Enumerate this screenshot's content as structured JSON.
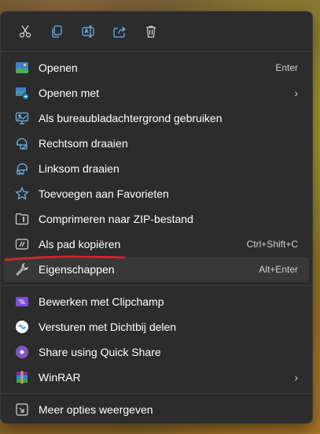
{
  "toolbar": [
    {
      "name": "cut-icon",
      "tooltip": "Knippen"
    },
    {
      "name": "copy-icon",
      "tooltip": "Kopiëren"
    },
    {
      "name": "rename-icon",
      "tooltip": "Naam wijzigen"
    },
    {
      "name": "share-icon",
      "tooltip": "Delen"
    },
    {
      "name": "delete-icon",
      "tooltip": "Verwijderen"
    }
  ],
  "group1": [
    {
      "label": "Openen",
      "shortcut": "Enter",
      "icon": "image-icon"
    },
    {
      "label": "Openen met",
      "shortcut": "",
      "icon": "open-with-icon",
      "submenu": true
    },
    {
      "label": "Als bureaubladachtergrond gebruiken",
      "shortcut": "",
      "icon": "wallpaper-icon"
    },
    {
      "label": "Rechtsom draaien",
      "shortcut": "",
      "icon": "rotate-right-icon"
    },
    {
      "label": "Linksom draaien",
      "shortcut": "",
      "icon": "rotate-left-icon"
    },
    {
      "label": "Toevoegen aan Favorieten",
      "shortcut": "",
      "icon": "star-icon"
    },
    {
      "label": "Comprimeren naar ZIP-bestand",
      "shortcut": "",
      "icon": "zip-folder-icon"
    },
    {
      "label": "Als pad kopiëren",
      "shortcut": "Ctrl+Shift+C",
      "icon": "copy-path-icon"
    },
    {
      "label": "Eigenschappen",
      "shortcut": "Alt+Enter",
      "icon": "wrench-icon"
    }
  ],
  "group2": [
    {
      "label": "Bewerken met Clipchamp",
      "shortcut": "",
      "icon": "clipchamp-icon"
    },
    {
      "label": "Versturen met Dichtbij delen",
      "shortcut": "",
      "icon": "nearby-share-icon"
    },
    {
      "label": "Share using Quick Share",
      "shortcut": "",
      "icon": "quick-share-icon"
    },
    {
      "label": "WinRAR",
      "shortcut": "",
      "icon": "winrar-icon",
      "submenu": true
    }
  ],
  "group3": [
    {
      "label": "Meer opties weergeven",
      "shortcut": "",
      "icon": "more-options-icon"
    }
  ],
  "chevron": "›",
  "accent": "#d9232d"
}
